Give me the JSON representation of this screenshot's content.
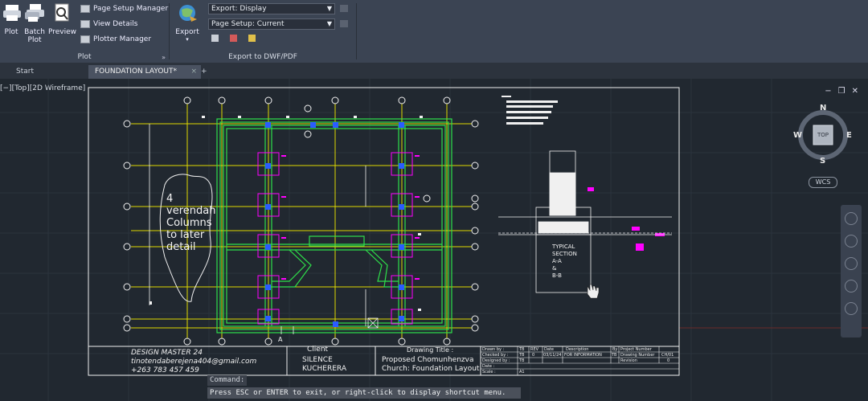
{
  "ribbon": {
    "plot_panel": {
      "title": "Plot",
      "plot_label": "Plot",
      "batch_plot_label_1": "Batch",
      "batch_plot_label_2": "Plot",
      "preview_label": "Preview",
      "page_setup_manager": "Page Setup Manager",
      "view_details": "View Details",
      "plotter_manager": "Plotter Manager",
      "expand_arrow": "»"
    },
    "export_panel": {
      "title": "Export to DWF/PDF",
      "export_label": "Export",
      "export_dropdown_value": "Export: Display",
      "page_setup_dropdown_value": "Page Setup: Current"
    }
  },
  "tabs": {
    "start": "Start",
    "active": "FOUNDATION LAYOUT*",
    "add": "+"
  },
  "viewport": {
    "label": "[−][Top][2D Wireframe]",
    "window_controls": [
      "−",
      "❐",
      "✕"
    ]
  },
  "viewcube": {
    "face": "TOP",
    "north": "N",
    "south": "S",
    "east": "E",
    "west": "W",
    "wcs": "WCS"
  },
  "drawing": {
    "note_lines": [
      "4",
      "verendah",
      "Columns",
      "to later",
      "detail"
    ],
    "section_label_lines": [
      "TYPICAL",
      "SECTION",
      "A-A",
      "&",
      "B-B"
    ],
    "axis_letter_bottom": "A"
  },
  "title_block": {
    "designer_lines": [
      "DESIGN MASTER 24",
      "tinotendaberejena404@gmail.com",
      "+263 783 457 459"
    ],
    "client_header": "Client",
    "client_lines": [
      "SILENCE",
      "KUCHERERA"
    ],
    "drawing_title_header": "Drawing Title :",
    "drawing_title_lines": [
      "Proposed Chomunhenzva",
      "Church: Foundation Layout"
    ],
    "small_labels": [
      "Drawn by :",
      "Checked by :",
      "Designed by :",
      "Date :",
      "Scale :"
    ],
    "small_values": [
      "TB",
      "TB",
      "TB",
      "",
      "A1"
    ],
    "rev_headers": [
      "REV",
      "Date",
      "Description",
      "By"
    ],
    "rev_row": [
      "0",
      "03/11/24",
      "FOR INFORMATION",
      "TB"
    ],
    "project_labels": [
      "Project Number",
      "Drawing Number",
      "Revision"
    ],
    "project_values": [
      "",
      "CH/01",
      "0"
    ]
  },
  "command": {
    "label": "Command:",
    "prompt": "Press ESC or ENTER to exit, or right-click to display shortcut menu."
  },
  "colors": {
    "ribbon_bg": "#3b4453",
    "canvas_bg": "#212830",
    "wall_green": "#2ee04a",
    "grid_yellow": "#e0d900",
    "column_magenta": "#ff00ff",
    "dim_blue": "#2a5cff"
  }
}
